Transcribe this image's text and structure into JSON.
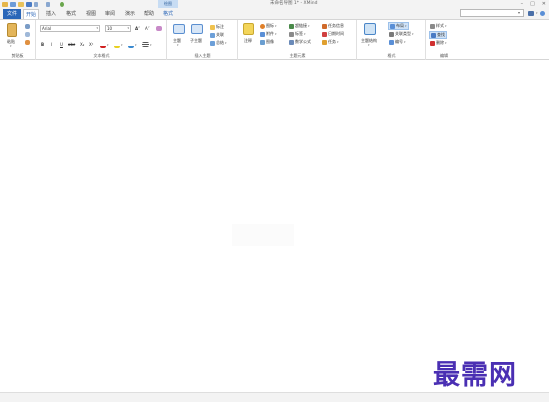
{
  "title_bar": {
    "context_tab": "绘图",
    "document_title": "未命名导图 1* - XMind"
  },
  "tabs": [
    {
      "label": "文件"
    },
    {
      "label": "开始"
    },
    {
      "label": "插入"
    },
    {
      "label": "格式"
    },
    {
      "label": "视图"
    },
    {
      "label": "审阅"
    },
    {
      "label": "演示"
    },
    {
      "label": "帮助"
    },
    {
      "label": "格式"
    }
  ],
  "ribbon": {
    "clipboard": {
      "paste_label": "粘贴",
      "group_label": "剪贴板"
    },
    "font": {
      "font_name": "Arial",
      "font_size": "10",
      "bold": "B",
      "italic": "I",
      "underline": "U",
      "strike": "abc",
      "subscript": "X₂",
      "superscript": "X²",
      "group_label": "文本格式"
    },
    "topic": {
      "main_topic_label": "主题",
      "subtopic_label": "子主题",
      "callout_label": "标注",
      "relationship_label": "关联",
      "summary_label": "总结",
      "group_label": "插入主题"
    },
    "elements": {
      "note_label": "注释",
      "marker_label": "图标",
      "attachment_label": "附件",
      "image_label": "图像",
      "label_label": "标签",
      "hyperlink_label": "超链接",
      "task_label": "任务信息",
      "date_label": "日期时间",
      "equation_label": "数学公式",
      "task2_label": "任务",
      "group_label": "主题元素"
    },
    "structure": {
      "structure_label": "主题结构",
      "layout_label": "布局",
      "relation_label": "关联类型",
      "numbering_label": "编号",
      "group_label": "格式"
    },
    "edit": {
      "style_label": "样式",
      "replace_label": "查找",
      "delete_label": "删除",
      "group_label": "编辑"
    }
  },
  "watermark": "最需网",
  "colors": {
    "accent": "#2a66b8",
    "watermark": "#4a2fb3"
  }
}
